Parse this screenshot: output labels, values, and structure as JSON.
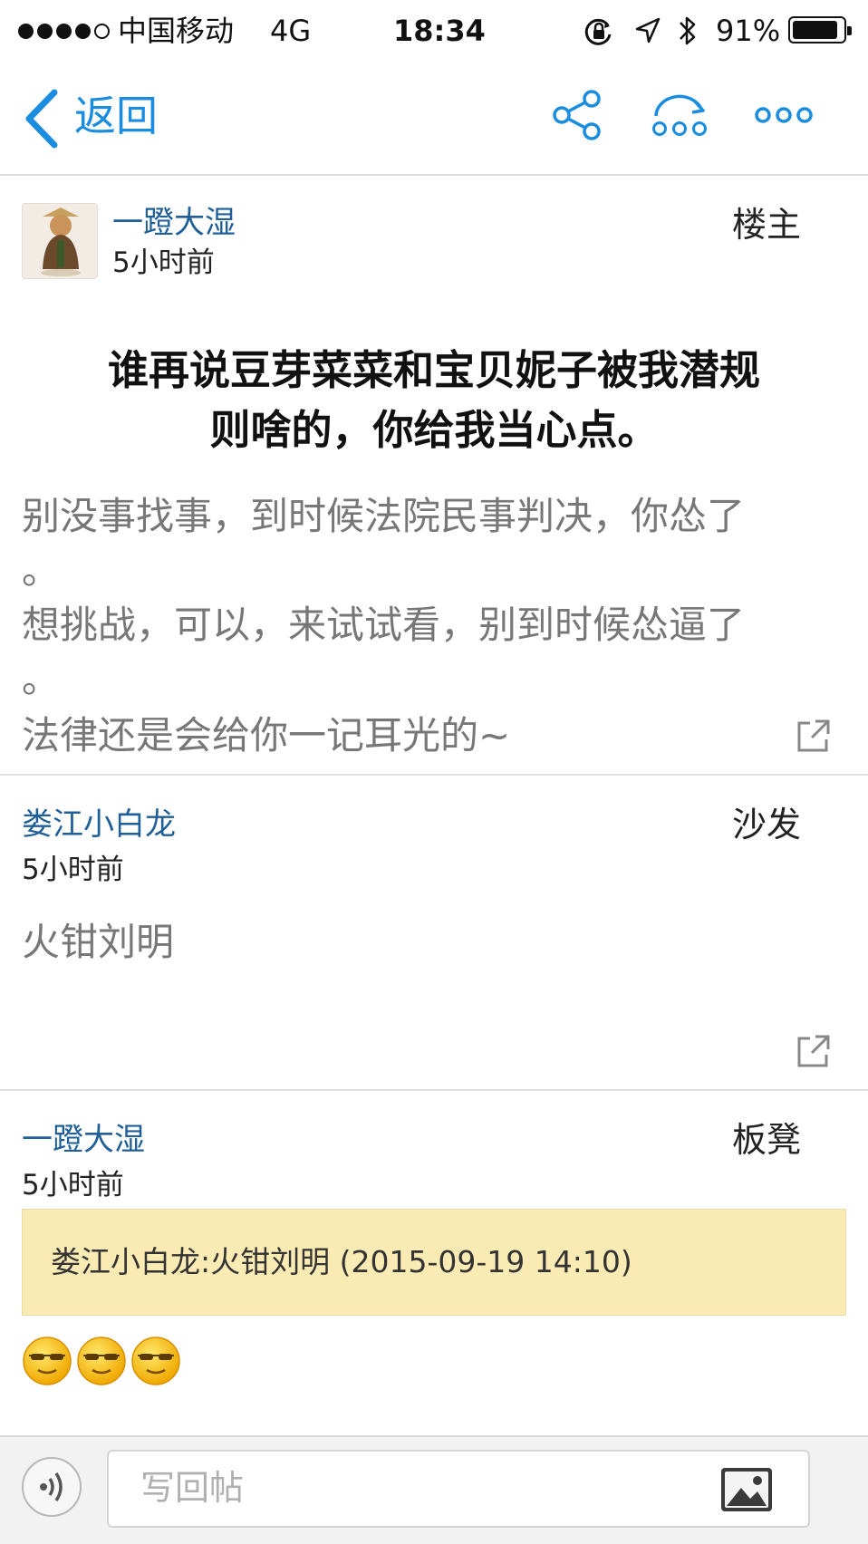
{
  "status_bar": {
    "carrier": "中国移动",
    "network": "4G",
    "time": "18:34",
    "battery": "91%",
    "battery_level": 0.91
  },
  "nav": {
    "back_label": "返回",
    "accent": "#1a8de0",
    "icons": [
      "share-icon",
      "refresh-more-icon",
      "more-icon"
    ]
  },
  "posts": [
    {
      "author": "一蹬大湿",
      "time": "5小时前",
      "floor": "楼主",
      "title": "谁再说豆芽菜菜和宝贝妮子被我潜规则啥的，你给我当心点。",
      "title_lines": [
        "谁再说豆芽菜菜和宝贝妮子被我潜规",
        "则啥的，你给我当心点。"
      ],
      "body_lines": [
        "别没事找事，到时候法院民事判决，你怂了",
        "。",
        "想挑战，可以，来试试看，别到时候怂逼了",
        "。",
        "法律还是会给你一记耳光的~"
      ]
    },
    {
      "author": "娄江小白龙",
      "time": "5小时前",
      "floor": "沙发",
      "body_lines": [
        "火钳刘明"
      ]
    },
    {
      "author": "一蹬大湿",
      "time": "5小时前",
      "floor": "板凳",
      "quote": "娄江小白龙:火钳刘明 (2015-09-19 14:10)",
      "emoji_count": 3
    }
  ],
  "reply": {
    "placeholder": "写回帖"
  },
  "colors": {
    "author": "#1f5f99",
    "quote_bg": "#faebb4"
  }
}
